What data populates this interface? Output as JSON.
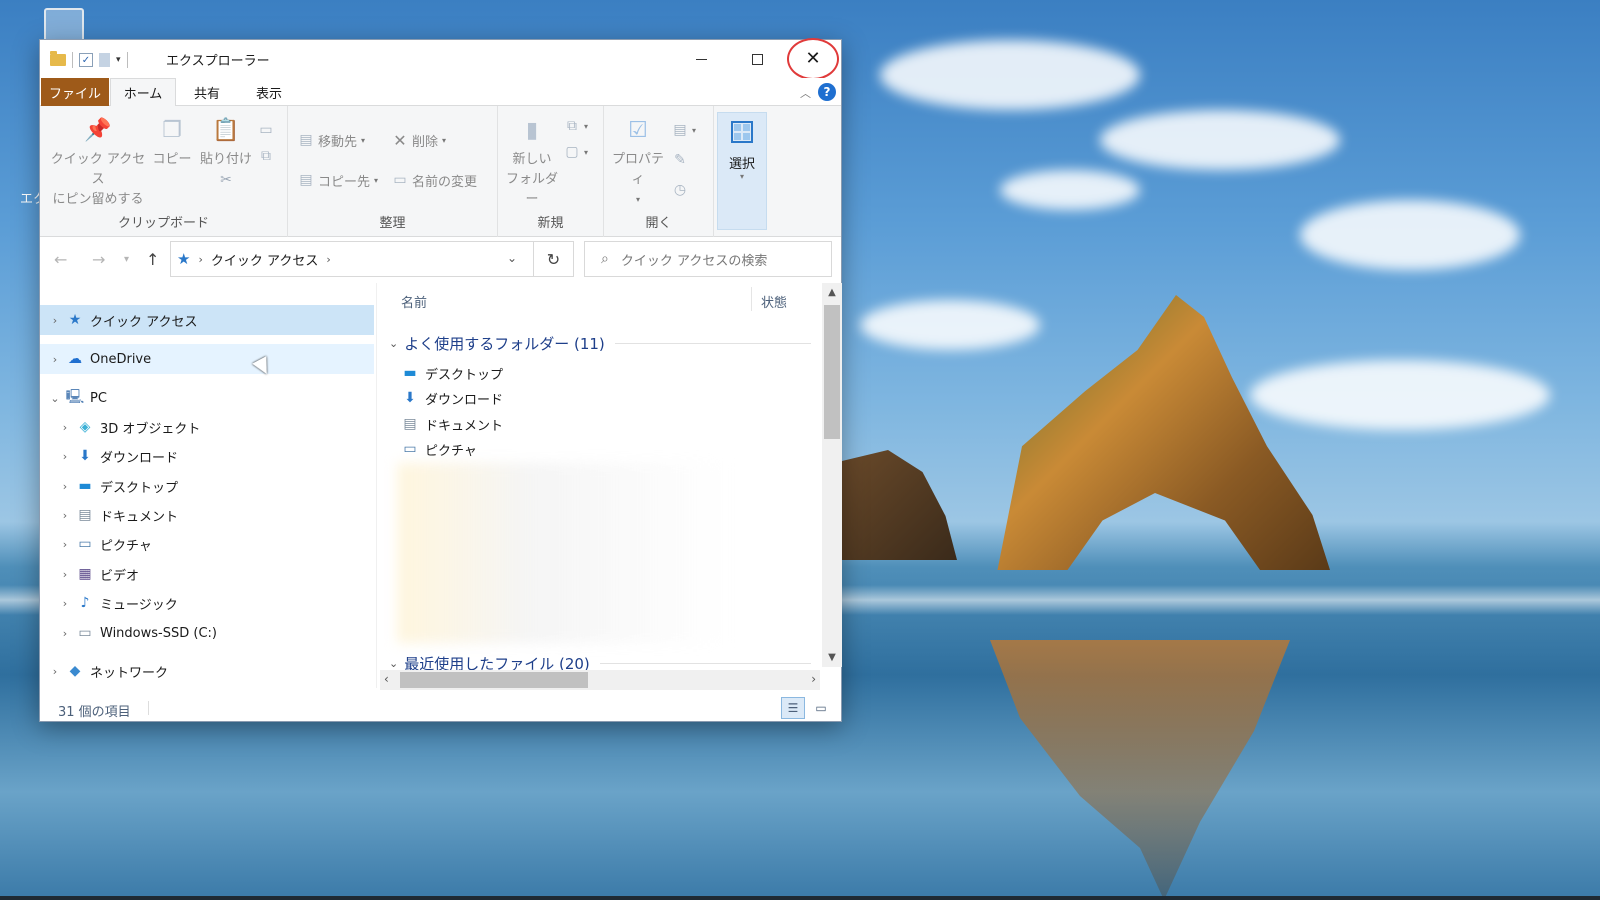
{
  "desktop": {
    "partial_label": "エク"
  },
  "window": {
    "title": "エクスプローラー",
    "controls": {
      "minimize": "—",
      "maximize": "☐",
      "close": "✕"
    }
  },
  "ribbon_tabs": {
    "file": "ファイル",
    "home": "ホーム",
    "share": "共有",
    "view": "表示",
    "help": "?"
  },
  "ribbon": {
    "clipboard": {
      "label": "クリップボード",
      "pin_line1": "クイック アクセス",
      "pin_line2": "にピン留めする",
      "copy": "コピー",
      "paste": "貼り付け"
    },
    "organize": {
      "label": "整理",
      "move_to": "移動先",
      "copy_to": "コピー先",
      "delete": "削除",
      "rename": "名前の変更"
    },
    "new": {
      "label": "新規",
      "new_folder_line1": "新しい",
      "new_folder_line2": "フォルダー"
    },
    "open": {
      "label": "開く",
      "properties": "プロパティ"
    },
    "select": {
      "label": "選択"
    }
  },
  "address": {
    "path": "クイック アクセス",
    "search_placeholder": "クイック アクセスの検索"
  },
  "nav_pane": {
    "items": [
      {
        "label": "クイック アクセス",
        "icon": "star-icon"
      },
      {
        "label": "OneDrive",
        "icon": "cloud-icon"
      },
      {
        "label": "PC",
        "icon": "computer-icon"
      },
      {
        "label": "3D オブジェクト",
        "icon": "cube-icon"
      },
      {
        "label": "ダウンロード",
        "icon": "download-icon"
      },
      {
        "label": "デスクトップ",
        "icon": "desktop-icon"
      },
      {
        "label": "ドキュメント",
        "icon": "document-icon"
      },
      {
        "label": "ピクチャ",
        "icon": "picture-icon"
      },
      {
        "label": "ビデオ",
        "icon": "video-icon"
      },
      {
        "label": "ミュージック",
        "icon": "music-icon"
      },
      {
        "label": "Windows-SSD (C:)",
        "icon": "drive-icon"
      },
      {
        "label": "ネットワーク",
        "icon": "network-icon"
      }
    ]
  },
  "content": {
    "columns": {
      "name": "名前",
      "status": "状態"
    },
    "frequent_header": "よく使用するフォルダー (11)",
    "frequent_items": [
      {
        "label": "デスクトップ",
        "icon": "desktop-icon"
      },
      {
        "label": "ダウンロード",
        "icon": "download-icon"
      },
      {
        "label": "ドキュメント",
        "icon": "document-icon"
      },
      {
        "label": "ピクチャ",
        "icon": "picture-icon"
      }
    ],
    "recent_header": "最近使用したファイル (20)"
  },
  "status_bar": {
    "count": "31 個の項目"
  },
  "colors": {
    "file_tab": "#9e5a19",
    "selection": "#cce4f7",
    "accent": "#2a78c9",
    "close_highlight": "#e03a3a"
  }
}
